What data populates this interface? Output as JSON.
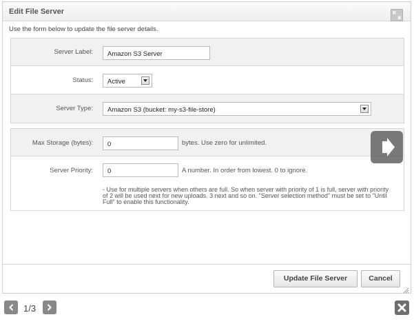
{
  "dialog": {
    "title": "Edit File Server",
    "intro": "Use the form below to update the file server details."
  },
  "form": {
    "server_label": {
      "label": "Server Label:",
      "value": "Amazon S3 Server"
    },
    "status": {
      "label": "Status:",
      "value": "Active"
    },
    "server_type": {
      "label": "Server Type:",
      "value": "Amazon S3 (bucket: my-s3-file-store)"
    },
    "max_storage": {
      "label": "Max Storage (bytes):",
      "value": "0",
      "hint": "bytes. Use zero for unlimited."
    },
    "server_priority": {
      "label": "Server Priority:",
      "value": "0",
      "hint": "A number. In order from lowest. 0 to ignore.",
      "note": "- Use for multiple servers when others are full. So when server with priority of 1 is full, server with priority of 2 will be used next for new uploads. 3 next and so on. \"Server selection method\" must be set to \"Until Full\" to enable this functionality."
    }
  },
  "buttons": {
    "update": "Update File Server",
    "cancel": "Cancel"
  },
  "gallery": {
    "counter": "1/3"
  },
  "icons": {
    "expand": "expand-icon",
    "next": "arrow-right-icon",
    "prev_page": "chevron-left-icon",
    "next_page": "chevron-right-icon",
    "close": "close-icon",
    "resize": "resize-grip-icon",
    "dropdown": "chevron-down-icon"
  }
}
